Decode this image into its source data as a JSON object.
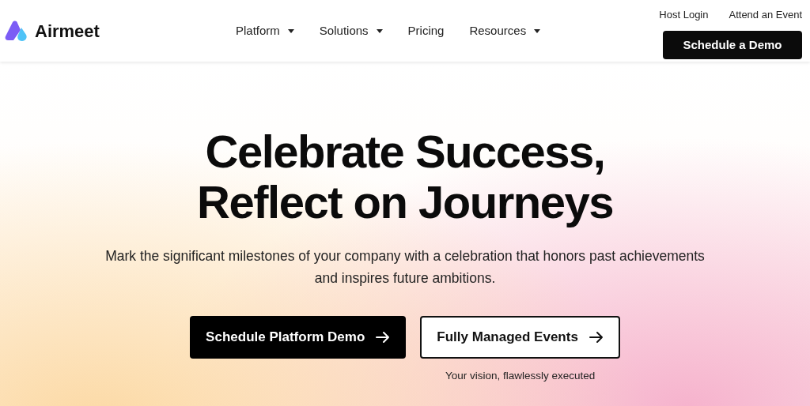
{
  "brand": {
    "name": "Airmeet"
  },
  "nav": [
    {
      "label": "Platform",
      "dropdown": true
    },
    {
      "label": "Solutions",
      "dropdown": true
    },
    {
      "label": "Pricing",
      "dropdown": false
    },
    {
      "label": "Resources",
      "dropdown": true
    }
  ],
  "top_links": [
    "Host Login",
    "Attend an Event"
  ],
  "header_button": "Schedule a Demo",
  "hero": {
    "title_lines": [
      "Celebrate Success,",
      "Reflect on Journeys"
    ],
    "subtitle": "Mark the significant milestones of your company with a celebration that honors past achievements and inspires future ambitions.",
    "buttons": [
      {
        "label": "Schedule Platform Demo",
        "kind": "primary"
      },
      {
        "label": "Fully Managed Events",
        "kind": "secondary",
        "caption": "Your vision, flawlessly executed"
      }
    ]
  }
}
